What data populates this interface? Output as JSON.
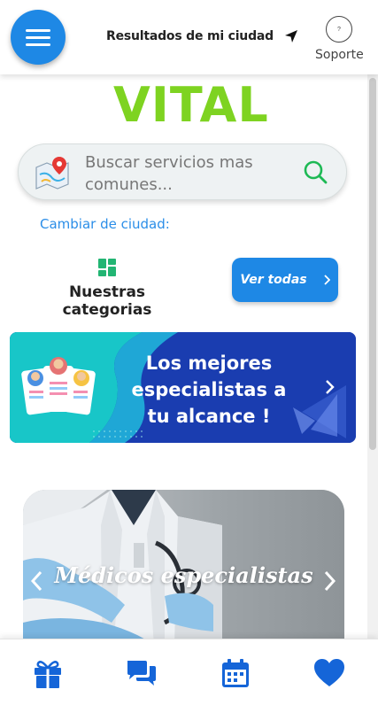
{
  "header": {
    "menu_icon": "hamburger-icon",
    "city_results_label": "Resultados de mi ciudad",
    "location_icon": "navigation-arrow-icon",
    "support_icon": "help-circle-icon",
    "support_icon_text": "?",
    "support_label": "Soporte"
  },
  "brand": {
    "logo_text": "VITAL",
    "logo_color": "#7ed321"
  },
  "search": {
    "placeholder": "Buscar servicios mas comunes...",
    "map_icon": "map-pin-icon",
    "search_icon": "search-icon",
    "icon_color": "#1db954"
  },
  "city": {
    "change_label": "Cambiar de ciudad:"
  },
  "categories": {
    "icon": "grid-icon",
    "title": "Nuestras categorias",
    "view_all_label": "Ver todas",
    "view_all_icon": "chevron-right-icon"
  },
  "banner": {
    "text": "Los mejores especialistas a tu alcance !",
    "chevron_icon": "chevron-right-icon"
  },
  "carousel": {
    "caption": "Médicos especialistas",
    "prev_icon": "chevron-left-icon",
    "next_icon": "chevron-right-icon"
  },
  "bottom_nav": {
    "items": [
      {
        "icon": "gift-icon"
      },
      {
        "icon": "chat-icon"
      },
      {
        "icon": "calendar-icon"
      },
      {
        "icon": "heart-icon"
      }
    ],
    "icon_color": "#1565d8"
  },
  "colors": {
    "primary": "#1e88e5",
    "banner_bg": "#1a3db0",
    "banner_accent": "#18c6c8",
    "link": "#2b8ee8"
  }
}
